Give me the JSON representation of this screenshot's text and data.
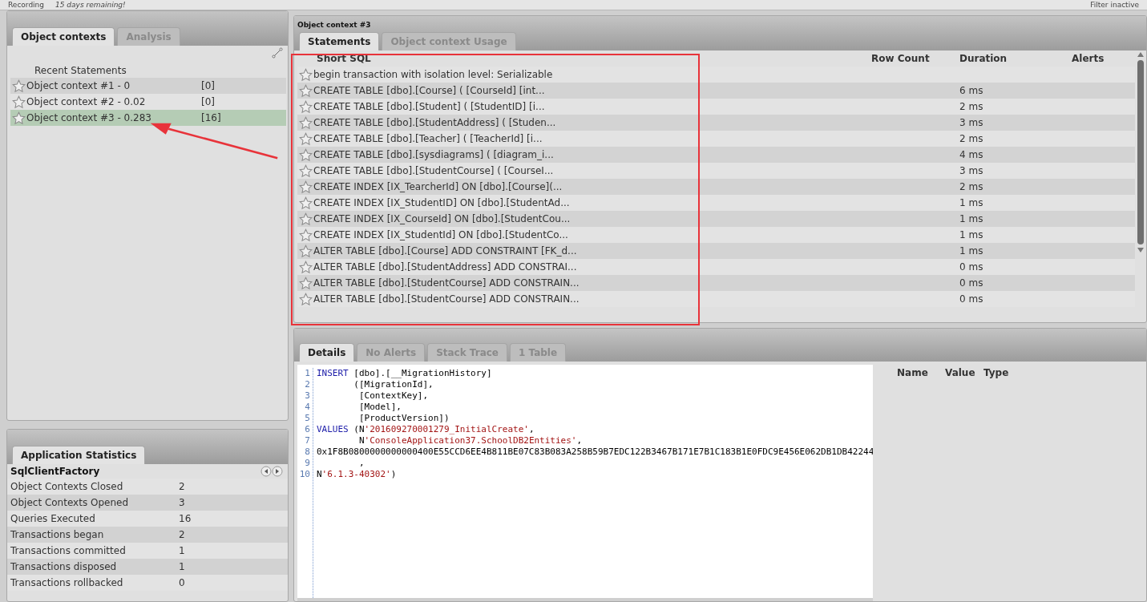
{
  "top_bar": {
    "items": [
      "Recording",
      "15 days remaining!"
    ],
    "filter": "Filter inactive"
  },
  "left_panel": {
    "tabs": [
      {
        "label": "Object contexts",
        "selected": true
      },
      {
        "label": "Analysis",
        "selected": false
      }
    ],
    "list_header": "Recent Statements",
    "contexts": [
      {
        "name": "Object context #1  - 0",
        "count": "[0]",
        "selected": false
      },
      {
        "name": "Object context #2  - 0.02",
        "count": "[0]",
        "selected": false
      },
      {
        "name": "Object context #3  - 0.283",
        "count": "[16]",
        "selected": true
      }
    ]
  },
  "statistics": {
    "tabs": [
      {
        "label": "Application Statistics",
        "selected": true
      }
    ],
    "factory": "SqlClientFactory",
    "rows": [
      {
        "label": "Object Contexts Closed",
        "value": "2"
      },
      {
        "label": "Object Contexts Opened",
        "value": "3"
      },
      {
        "label": "Queries Executed",
        "value": "16"
      },
      {
        "label": "Transactions began",
        "value": "2"
      },
      {
        "label": "Transactions committed",
        "value": "1"
      },
      {
        "label": "Transactions disposed",
        "value": "1"
      },
      {
        "label": "Transactions rollbacked",
        "value": "0"
      }
    ]
  },
  "statements_panel": {
    "title": "Object context #3",
    "tabs": [
      {
        "label": "Statements",
        "selected": true
      },
      {
        "label": "Object context Usage",
        "selected": false
      }
    ],
    "columns": [
      "Short SQL",
      "Row Count",
      "Duration",
      "Alerts"
    ],
    "rows": [
      {
        "sql": "begin transaction with isolation level: Serializable",
        "duration": ""
      },
      {
        "sql": "CREATE TABLE [dbo].[Course] (   [CourseId] [int...",
        "duration": "6 ms"
      },
      {
        "sql": "CREATE TABLE [dbo].[Student] (   [StudentID] [i...",
        "duration": "2 ms"
      },
      {
        "sql": "CREATE TABLE [dbo].[StudentAddress] (   [Studen...",
        "duration": "3 ms"
      },
      {
        "sql": "CREATE TABLE [dbo].[Teacher] (   [TeacherId] [i...",
        "duration": "2 ms"
      },
      {
        "sql": "CREATE TABLE [dbo].[sysdiagrams] (   [diagram_i...",
        "duration": "4 ms"
      },
      {
        "sql": "CREATE TABLE [dbo].[StudentCourse] (   [CourseI...",
        "duration": "3 ms"
      },
      {
        "sql": "CREATE INDEX [IX_TearcherId] ON [dbo].[Course](...",
        "duration": "2 ms"
      },
      {
        "sql": "CREATE INDEX [IX_StudentID] ON [dbo].[StudentAd...",
        "duration": "1 ms"
      },
      {
        "sql": "CREATE INDEX [IX_CourseId] ON [dbo].[StudentCou...",
        "duration": "1 ms"
      },
      {
        "sql": "CREATE INDEX [IX_StudentId] ON [dbo].[StudentCo...",
        "duration": "1 ms"
      },
      {
        "sql": "ALTER TABLE [dbo].[Course] ADD CONSTRAINT [FK_d...",
        "duration": "1 ms"
      },
      {
        "sql": "ALTER TABLE [dbo].[StudentAddress] ADD CONSTRAI...",
        "duration": "0 ms"
      },
      {
        "sql": "ALTER TABLE [dbo].[StudentCourse] ADD CONSTRAIN...",
        "duration": "0 ms"
      },
      {
        "sql": "ALTER TABLE [dbo].[StudentCourse] ADD CONSTRAIN...",
        "duration": "0 ms"
      }
    ]
  },
  "details_panel": {
    "tabs": [
      {
        "label": "Details",
        "selected": true
      },
      {
        "label": "No Alerts",
        "selected": false
      },
      {
        "label": "Stack Trace",
        "selected": false
      },
      {
        "label": "1 Table",
        "selected": false
      }
    ],
    "code_lines": [
      {
        "number": "1",
        "parts": [
          {
            "kind": "keyword",
            "text": "INSERT"
          },
          {
            "kind": "plain",
            "text": " [dbo].[__MigrationHistory]"
          }
        ]
      },
      {
        "number": "2",
        "parts": [
          {
            "kind": "plain",
            "text": "       ([MigrationId],"
          }
        ]
      },
      {
        "number": "3",
        "parts": [
          {
            "kind": "plain",
            "text": "        [ContextKey],"
          }
        ]
      },
      {
        "number": "4",
        "parts": [
          {
            "kind": "plain",
            "text": "        [Model],"
          }
        ]
      },
      {
        "number": "5",
        "parts": [
          {
            "kind": "plain",
            "text": "        [ProductVersion])"
          }
        ]
      },
      {
        "number": "6",
        "parts": [
          {
            "kind": "keyword",
            "text": "VALUES"
          },
          {
            "kind": "plain",
            "text": " (N"
          },
          {
            "kind": "string",
            "text": "'201609270001279_InitialCreate'"
          },
          {
            "kind": "plain",
            "text": ","
          }
        ]
      },
      {
        "number": "7",
        "parts": [
          {
            "kind": "plain",
            "text": "        N"
          },
          {
            "kind": "string",
            "text": "'ConsoleApplication37.SchoolDB2Entities'"
          },
          {
            "kind": "plain",
            "text": ","
          }
        ]
      },
      {
        "number": "8",
        "parts": [
          {
            "kind": "plain",
            "text": "0x1F8B0800000000000400E55CCD6EE4B811BE07C83B083A258B59B7EDC122B3467B171E7B1C183B1E0FDC9E456E062DB1DB42244"
          }
        ]
      },
      {
        "number": "9",
        "parts": [
          {
            "kind": "plain",
            "text": "        ,"
          }
        ]
      },
      {
        "number": "10",
        "parts": [
          {
            "kind": "plain",
            "text": "N"
          },
          {
            "kind": "string",
            "text": "'6.1.3-40302'"
          },
          {
            "kind": "plain",
            "text": ")"
          }
        ]
      }
    ],
    "property_columns": [
      "Name",
      "Value",
      "Type"
    ]
  },
  "annotation": {
    "frame": true,
    "arrow": true
  }
}
